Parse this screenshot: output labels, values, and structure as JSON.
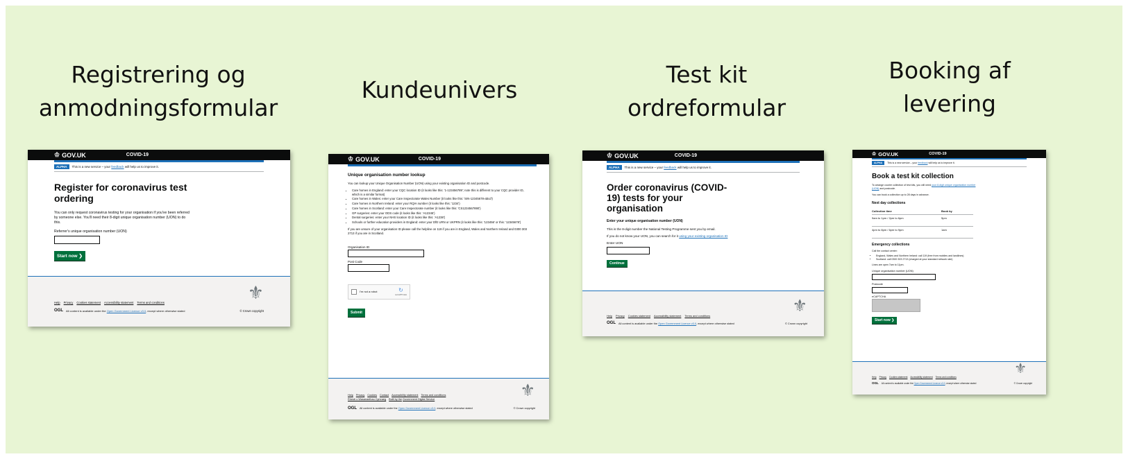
{
  "slide": {
    "background": "#e8f5d4"
  },
  "titles": [
    {
      "line1": "Registrering og",
      "line2": "anmodningsformular"
    },
    {
      "line1": "Kundeunivers",
      "line2": ""
    },
    {
      "line1": "Test kit",
      "line2": "ordreformular"
    },
    {
      "line1": "Booking af",
      "line2": "levering"
    }
  ],
  "common": {
    "brand": "GOV.UK",
    "service": "COVID-19",
    "phase_tag": "ALPHA",
    "phase_text_pre": "This is a new service – your",
    "phase_link": "feedback",
    "phase_text_post": "will help us to improve it.",
    "crown_glyph": "♔",
    "crest_glyph": "⚜",
    "footer_links": [
      "Help",
      "Privacy",
      "Cookies statement",
      "Accessibility statement",
      "Terms and conditions"
    ],
    "ogl": "OGL",
    "license_pre": "All content is available under the",
    "license_link": "Open Government Licence v3.0",
    "license_post": ", except where otherwise stated",
    "copyright": "© Crown copyright"
  },
  "screen1": {
    "heading": "Register for coronavirus test ordering",
    "body": "You can only request coronavirus testing for your organisation if you've been referred by someone else. You'll need their 8-digit unique organisation number (UON) to do this.",
    "label": "Referrer's unique organisation number (UON)",
    "button": "Start now"
  },
  "screen2": {
    "heading": "Unique organisation number lookup",
    "intro": "You can lookup your Unique Organisation Number (UON) using your existing organisation ID and postcode.",
    "bullets": [
      "Care homes in England: enter your CQC location ID (it looks like this: '1-123456789'; note this is different to your CQC provider ID, which is a similar format)",
      "Care homes in Wales: enter your Care Inspectorate Wales Number (it looks like this: 'SIN-12345678-abcd')",
      "Care homes in Northern Ireland: enter your RQIA number (it looks like this: '1234')",
      "Care homes in Scotland: enter your Care Inspectorate number (it looks like this: 'CS1234567890')",
      "GP surgeries: enter your ODS code (it looks like this: 'A12345')",
      "Dental surgeries: enter your NHS location ID (it looks like this: 'A1238')",
      "Schools or further education providers in England: enter your DfE URN or UKPRN (it looks like this: '123456' or this: '12345678')"
    ],
    "helpline": "If you are unsure of your organisation ID please call the helpline on 119 if you are in England, Wales and Northern Ireland and 0300 303 2713 if you are in Scotland.",
    "org_label": "Organisation ID",
    "postcode_label": "Post Code",
    "captcha": "I'm not a robot",
    "captcha_brand": "reCAPTCHA",
    "button": "Submit",
    "footer_links": [
      "Help",
      "Privacy",
      "Cookies",
      "Contact",
      "Accessibility statement",
      "Terms and conditions"
    ],
    "footer_links2": [
      "Rhestr o Wasanaethau Cymraeg"
    ],
    "built_by_pre": "Built by the",
    "built_by_link": "Government Digital Service"
  },
  "screen3": {
    "heading": "Order coronavirus (COVID-19) tests for your organisation",
    "subheading": "Enter your unique organisation number (UON)",
    "body": "This is the 8-digit number the National Testing Programme sent you by email.",
    "help_pre": "If you do not know your UON, you can search for it",
    "help_link": "using your existing organisation ID",
    "label": "Enter UON",
    "button": "Continue"
  },
  "screen4": {
    "heading": "Book a test kit collection",
    "intro_pre": "To arrange courier collection of test kits, you will need",
    "intro_link": "your 8-digit unique organisation number (UON)",
    "intro_post": "and postcode.",
    "advance": "You can book a collection up to 28 days in advance.",
    "next_day_heading": "Next day collections",
    "col1": "Collection time",
    "col2": "Book by",
    "rows": [
      {
        "time": "9am to 1pm / 2pm to 6pm",
        "book": "5pm"
      },
      {
        "time": "4pm to 8pm / 6pm to 9pm",
        "book": "1am"
      }
    ],
    "emergency_heading": "Emergency collections",
    "emergency_intro": "Call the contact centre:",
    "emergency_bullets": [
      "England, Wales and Northern Ireland: call 119 (free from mobiles and landlines)",
      "Scotland: call 0300 303 2713 (charged at your standard network rate)"
    ],
    "lines_open": "Lines are open 7am to 11pm.",
    "uon_label": "Unique organisation number (UON)",
    "postcode_label": "Postcode",
    "captcha_label": "eCAPTCHA",
    "button": "Start now"
  }
}
